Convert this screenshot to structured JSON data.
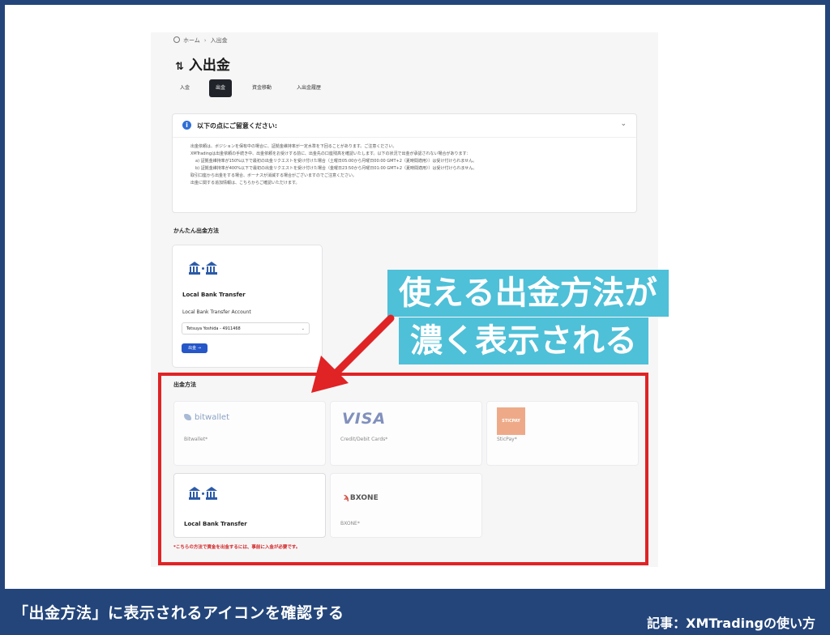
{
  "breadcrumb": {
    "home": "ホーム",
    "current": "入出金"
  },
  "page_title": "入出金",
  "tabs": [
    {
      "label": "入金"
    },
    {
      "label": "出金"
    },
    {
      "label": "資金移動"
    },
    {
      "label": "入出金履歴"
    }
  ],
  "notice": {
    "title": "以下の点にご留意ください:",
    "items": [
      "出金依頼は、ボジションを保有中の場合に、証拠金維持率が一定水準を下回ることがあります。ご注意ください。",
      "XMTradingは出金依頼の手続き中、出金依頼をお受けする前に、出金先の口座残高を確認いたします。以下の状況で出金が承認されない場合があります：",
      "a) 証拠金維持率が150%以下で最初の出金リクエストを受け付けた場合（土曜日05:00から月曜日00:00 GMT+2（夏時間適用））は受け付けられません。",
      "b) 証拠金維持率が400%以下で最初の出金リクエストを受け付けた場合（金曜日23:50から月曜日01:00 GMT+2（夏時間適用））は受け付けられません。",
      "取引口座から出金をする場合、ボーナスが消滅する場合がございますのでご注意ください。",
      "出金に関する追加情報は、こちらからご確認いただけます。"
    ]
  },
  "easy_section": {
    "label": "かんたん出金方法",
    "card_name": "Local Bank Transfer",
    "account_label": "Local Bank Transfer Account",
    "account_value": "Tetsuya Yoshida - 4911468",
    "button": "出金 →"
  },
  "methods_section": {
    "label": "出金方法",
    "methods": [
      {
        "name": "Bitwallet*",
        "logo": "bitwallet"
      },
      {
        "name": "Credit/Debit Cards*",
        "logo": "VISA"
      },
      {
        "name": "SticPay*",
        "logo": "STICPAY"
      },
      {
        "name": "Local Bank Transfer",
        "logo": "bank-icon"
      },
      {
        "name": "BXONE*",
        "logo": "BXONE"
      }
    ],
    "warning": "*こちらの方法で資金を出金するには、事前に入金が必要です。"
  },
  "callout": {
    "line1": "使える出金方法が",
    "line2": "濃く表示される"
  },
  "footer": {
    "caption": "「出金方法」に表示されるアイコンを確認する",
    "credit": "記事：XMTradingの使い方"
  },
  "colors": {
    "frame": "#23457a",
    "highlight": "#e02325",
    "callout": "#4ec0d8",
    "primary_button": "#2557c9"
  }
}
